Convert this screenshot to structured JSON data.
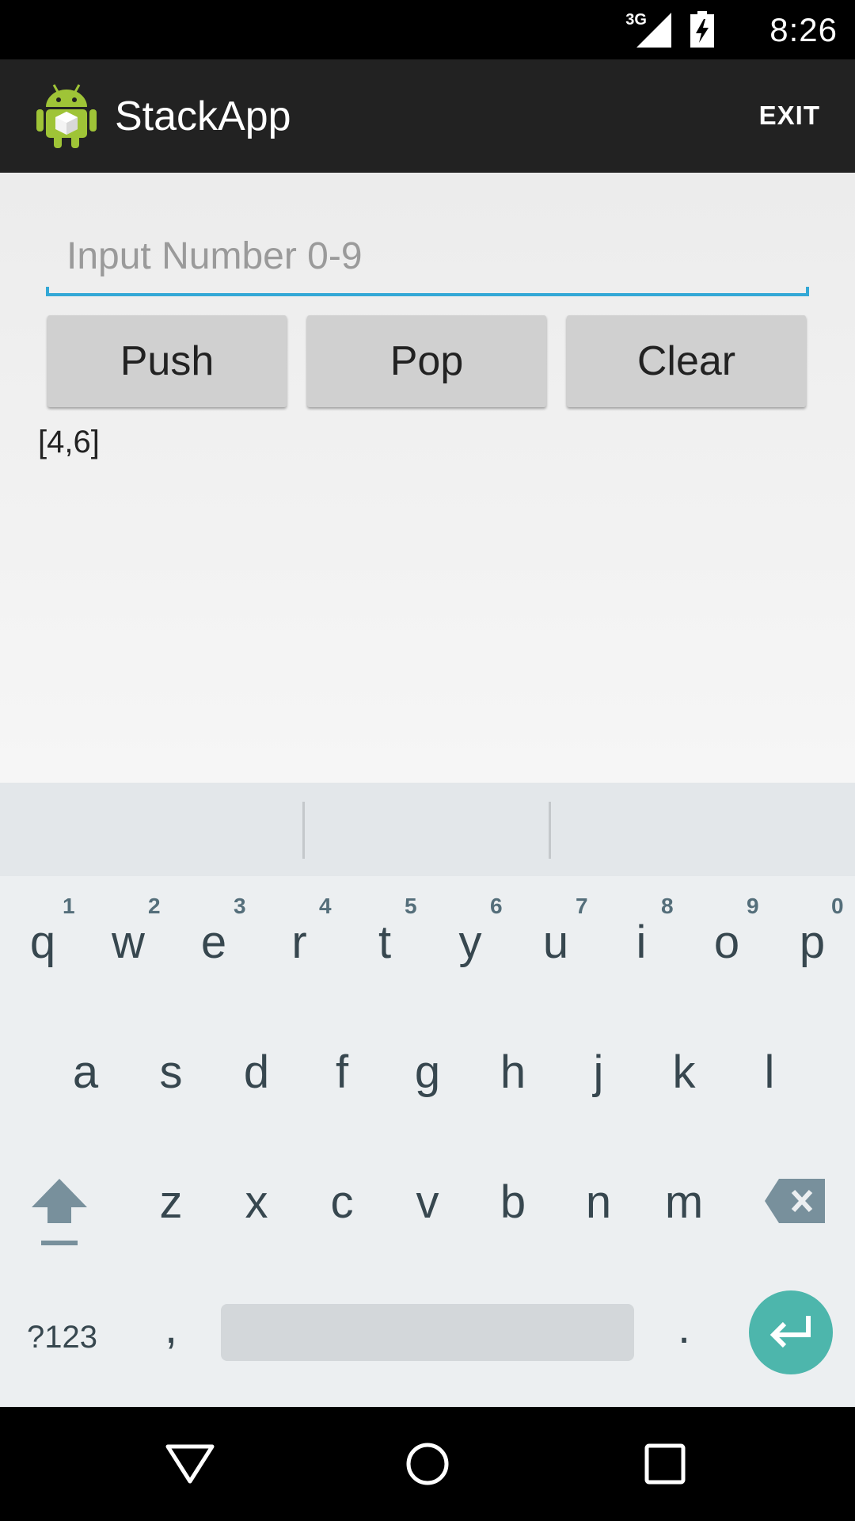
{
  "status_bar": {
    "network": "3G",
    "time": "8:26",
    "icons": [
      "signal-icon",
      "battery-charging-icon"
    ]
  },
  "app": {
    "title": "StackApp",
    "exit_label": "EXIT",
    "icon": "android-app-icon"
  },
  "form": {
    "input_placeholder": "Input Number 0-9",
    "input_value": "",
    "buttons": {
      "push": "Push",
      "pop": "Pop",
      "clear": "Clear"
    },
    "stack_display": "[4,6]"
  },
  "keyboard": {
    "row1": [
      "q",
      "w",
      "e",
      "r",
      "t",
      "y",
      "u",
      "i",
      "o",
      "p"
    ],
    "row1_hints": [
      "1",
      "2",
      "3",
      "4",
      "5",
      "6",
      "7",
      "8",
      "9",
      "0"
    ],
    "row2": [
      "a",
      "s",
      "d",
      "f",
      "g",
      "h",
      "j",
      "k",
      "l"
    ],
    "row3": [
      "z",
      "x",
      "c",
      "v",
      "b",
      "n",
      "m"
    ],
    "symbols_label": "?123",
    "comma": ",",
    "period": ".",
    "colors": {
      "background": "#eceff1",
      "keys": "#37474f",
      "enter": "#4db6ac"
    }
  },
  "colors": {
    "accent": "#33a8d6",
    "action_bar": "#222222",
    "button": "#d0d0d0"
  }
}
